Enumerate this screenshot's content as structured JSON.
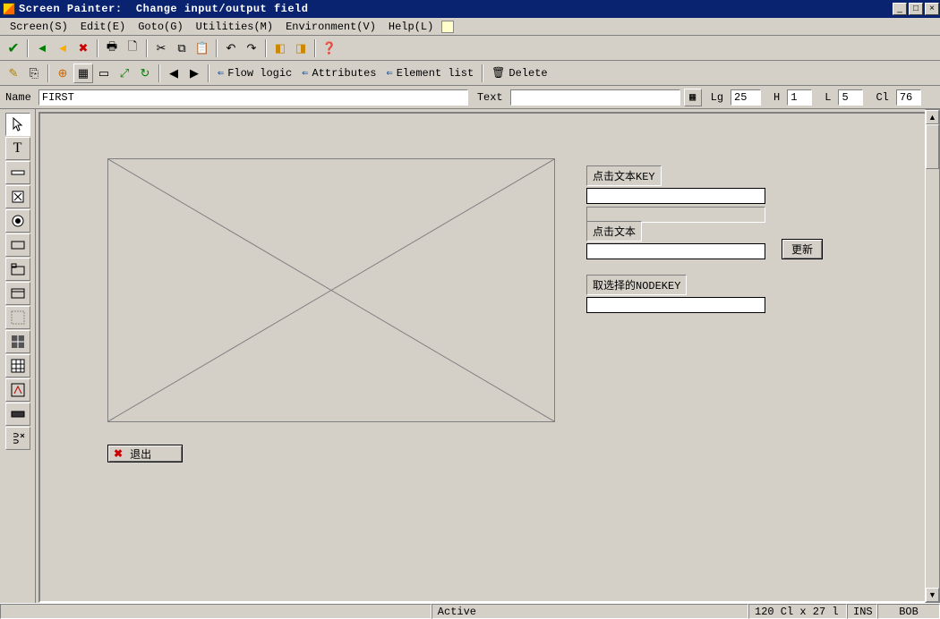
{
  "window": {
    "title": "Screen Painter:  Change input/output field"
  },
  "menu": {
    "items": [
      "Screen(S)",
      "Edit(E)",
      "Goto(G)",
      "Utilities(M)",
      "Environment(V)",
      "Help(L)"
    ]
  },
  "toolbar2": {
    "flow_logic": "Flow logic",
    "attributes": "Attributes",
    "element_list": "Element list",
    "delete": "Delete"
  },
  "props": {
    "name_label": "Name",
    "name_value": "FIRST",
    "text_label": "Text",
    "text_value": "",
    "lg_label": "Lg",
    "lg_value": "25",
    "h_label": "H",
    "h_value": "1",
    "l_label": "L",
    "l_value": "5",
    "cl_label": "Cl",
    "cl_value": "76"
  },
  "canvas": {
    "label_key": "点击文本KEY",
    "label_text": "点击文本",
    "btn_update": "更新",
    "label_nodekey": "取选择的NODEKEY",
    "btn_exit": "退出"
  },
  "status": {
    "mode": "Active",
    "pos": "120 Cl x 27 l",
    "ins": "INS",
    "user": "BOB"
  }
}
